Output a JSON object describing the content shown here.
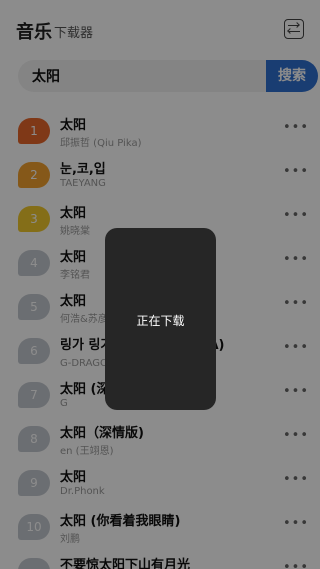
{
  "header": {
    "title": "音乐",
    "subtitle": "下载器",
    "action_icon": "swap-icon"
  },
  "search": {
    "query": "太阳",
    "button_label": "搜索"
  },
  "songs": [
    {
      "rank": "1",
      "title": "太阳",
      "artist": "邱振哲 (Qiu Pika)",
      "badge_color": "#e8662a"
    },
    {
      "rank": "2",
      "title": "눈,코,입",
      "artist": "TAEYANG",
      "badge_color": "#f2a12f"
    },
    {
      "rank": "3",
      "title": "太阳",
      "artist": "姚晓棠",
      "badge_color": "#f0c92d"
    },
    {
      "rank": "4",
      "title": "太阳",
      "artist": "李铭君",
      "badge_color": "#c4c9cf"
    },
    {
      "rank": "5",
      "title": "太阳",
      "artist": "何浩&苏彦",
      "badge_color": "#c4c9cf"
    },
    {
      "rank": "6",
      "title": "링가 링가 (RINGA LINGA)",
      "artist": "G-DRAGON&太阳",
      "badge_color": "#c4c9cf"
    },
    {
      "rank": "7",
      "title": "太阳 (深情版)",
      "artist": "G",
      "badge_color": "#c4c9cf"
    },
    {
      "rank": "8",
      "title": "太阳（深情版)",
      "artist": "en (王翊恩)",
      "badge_color": "#c4c9cf"
    },
    {
      "rank": "9",
      "title": "太阳",
      "artist": "Dr.Phonk",
      "badge_color": "#c4c9cf"
    },
    {
      "rank": "10",
      "title": "太阳 (你看着我眼睛)",
      "artist": "刘鹏",
      "badge_color": "#c4c9cf"
    },
    {
      "rank": "",
      "title": "不要惊太阳下山有月光",
      "artist": "",
      "badge_color": "#c4c9cf"
    }
  ],
  "more_label": "•••",
  "toast": {
    "text": "正在下载"
  }
}
